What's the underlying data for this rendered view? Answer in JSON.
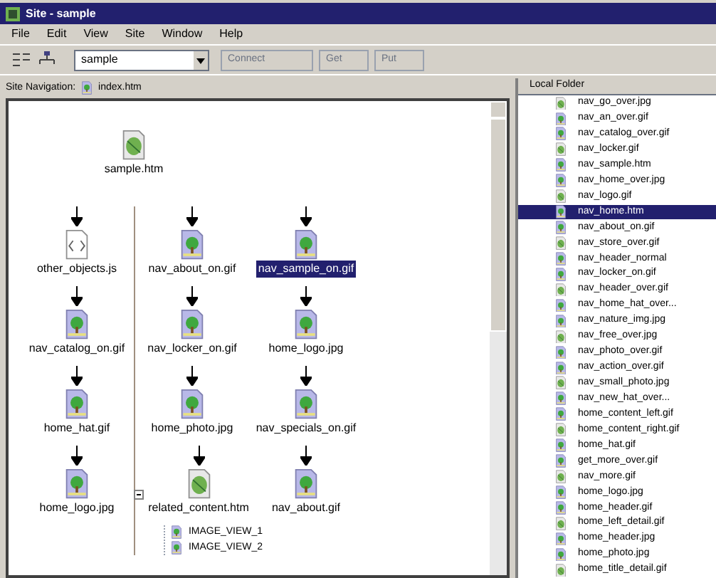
{
  "window": {
    "title": "Site - sample"
  },
  "menu": [
    "File",
    "Edit",
    "View",
    "Site",
    "Window",
    "Help"
  ],
  "toolbar": {
    "site": "sample",
    "buttons": [
      "Connect",
      "Get",
      "Put"
    ]
  },
  "navigation": {
    "label": "Site Navigation:",
    "file": "index.htm",
    "root": {
      "label": "sample.htm",
      "kind": "page"
    },
    "columns": [
      [
        {
          "label": "other_objects.js",
          "kind": "script",
          "selected": false
        },
        {
          "label": "nav_catalog_on.gif",
          "kind": "image",
          "selected": false
        },
        {
          "label": "home_hat.gif",
          "kind": "image",
          "selected": false
        },
        {
          "label": "home_logo.jpg",
          "kind": "image",
          "selected": false
        }
      ],
      [
        {
          "label": "nav_about_on.gif",
          "kind": "image",
          "selected": false
        },
        {
          "label": "nav_locker_on.gif",
          "kind": "image",
          "selected": false
        },
        {
          "label": "home_photo.jpg",
          "kind": "image",
          "selected": false
        },
        {
          "label": "related_content.htm",
          "kind": "page",
          "selected": false,
          "expanded": true,
          "children": [
            {
              "label": "IMAGE_VIEW_1"
            },
            {
              "label": "IMAGE_VIEW_2"
            }
          ]
        }
      ],
      [
        {
          "label": "nav_sample_on.gif",
          "kind": "image",
          "selected": true
        },
        {
          "label": "home_logo.jpg",
          "kind": "image",
          "selected": false
        },
        {
          "label": "nav_specials_on.gif",
          "kind": "image",
          "selected": false
        },
        {
          "label": "nav_about.gif",
          "kind": "image",
          "selected": false
        }
      ]
    ]
  },
  "local_folder": {
    "title": "Local Folder",
    "items": [
      {
        "label": "nav_go_over.jpg",
        "kind": "page",
        "selected": false
      },
      {
        "label": "nav_an_over.gif",
        "kind": "image",
        "selected": false
      },
      {
        "label": "nav_catalog_over.gif",
        "kind": "image",
        "selected": false
      },
      {
        "label": "nav_locker.gif",
        "kind": "page",
        "selected": false
      },
      {
        "label": "nav_sample.htm",
        "kind": "image",
        "selected": false
      },
      {
        "label": "nav_home_over.jpg",
        "kind": "image",
        "selected": false
      },
      {
        "label": "nav_logo.gif",
        "kind": "page",
        "selected": false
      },
      {
        "label": "nav_home.htm",
        "kind": "image",
        "selected": true
      },
      {
        "label": "nav_about_on.gif",
        "kind": "image",
        "selected": false
      },
      {
        "label": "nav_store_over.gif",
        "kind": "page",
        "selected": false
      },
      {
        "label": "nav_header_normal",
        "kind": "image",
        "selected": false
      },
      {
        "label": "nav_locker_on.gif",
        "kind": "image",
        "selected": false
      },
      {
        "label": "nav_header_over.gif",
        "kind": "page",
        "selected": false
      },
      {
        "label": "nav_home_hat_over...",
        "kind": "image",
        "selected": false
      },
      {
        "label": "nav_nature_img.jpg",
        "kind": "image",
        "selected": false
      },
      {
        "label": "nav_free_over.jpg",
        "kind": "page",
        "selected": false
      },
      {
        "label": "nav_photo_over.gif",
        "kind": "image",
        "selected": false
      },
      {
        "label": "nav_action_over.gif",
        "kind": "image",
        "selected": false
      },
      {
        "label": "nav_small_photo.jpg",
        "kind": "page",
        "selected": false
      },
      {
        "label": "nav_new_hat_over...",
        "kind": "image",
        "selected": false
      },
      {
        "label": "home_content_left.gif",
        "kind": "image",
        "selected": false
      },
      {
        "label": "home_content_right.gif",
        "kind": "page",
        "selected": false
      },
      {
        "label": "home_hat.gif",
        "kind": "image",
        "selected": false
      },
      {
        "label": "get_more_over.gif",
        "kind": "image",
        "selected": false
      },
      {
        "label": "nav_more.gif",
        "kind": "page",
        "selected": false
      },
      {
        "label": "home_logo.jpg",
        "kind": "image",
        "selected": false
      },
      {
        "label": "home_header.gif",
        "kind": "image",
        "selected": false
      },
      {
        "label": "home_left_detail.gif",
        "kind": "page",
        "selected": false
      },
      {
        "label": "home_header.jpg",
        "kind": "image",
        "selected": false
      },
      {
        "label": "home_photo.jpg",
        "kind": "image",
        "selected": false
      },
      {
        "label": "home_title_detail.gif",
        "kind": "page",
        "selected": false
      }
    ]
  }
}
